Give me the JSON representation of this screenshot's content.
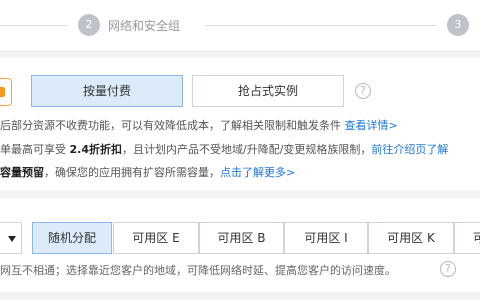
{
  "steps": {
    "step2_number": "2",
    "step2_label": "网络和安全组",
    "step3_number": "3"
  },
  "billing": {
    "options": [
      "按量付费",
      "抢占式实例"
    ],
    "selected": "按量付费",
    "help_glyph": "?",
    "line1": {
      "text": "后部分资源不收费功能，可以有效降低成本，了解相关限制和触发条件 ",
      "link": "查看详情>"
    },
    "line2": {
      "prefix": "单最高可享受 ",
      "bold": "2.4折折扣",
      "text": "，且计划内产品不受地域/升降配/变更规格族限制，",
      "link": "前往介绍页了解"
    },
    "line3": {
      "bold": "容量预留",
      "text": "，确保您的应用拥有扩容所需容量，",
      "link": "点击了解更多>"
    }
  },
  "zones": {
    "options": [
      "随机分配",
      "可用区 E",
      "可用区 B",
      "可用区 I",
      "可用区 K",
      "可"
    ],
    "selected": "随机分配",
    "tip": "网互不相通；选择靠近您客户的地域，可降低网络时延、提高您客户的访问速度。",
    "help_glyph": "?"
  },
  "colors": {
    "accent": "#1d76d8",
    "selected_bg": "#dcebfa",
    "warning": "#f59a23"
  }
}
